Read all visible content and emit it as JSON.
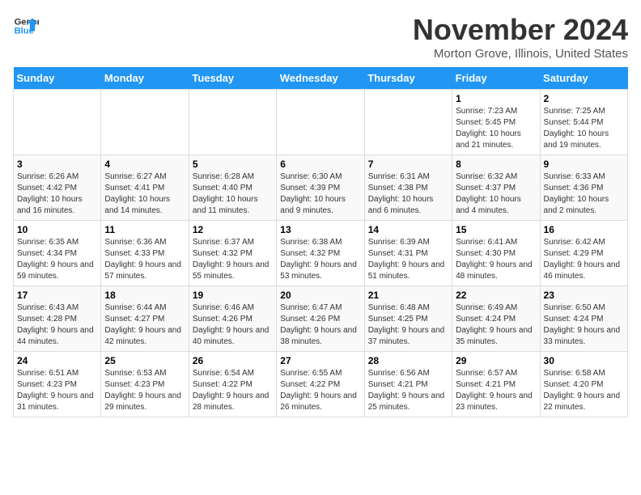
{
  "header": {
    "logo_line1": "General",
    "logo_line2": "Blue",
    "month_title": "November 2024",
    "location": "Morton Grove, Illinois, United States"
  },
  "weekdays": [
    "Sunday",
    "Monday",
    "Tuesday",
    "Wednesday",
    "Thursday",
    "Friday",
    "Saturday"
  ],
  "weeks": [
    [
      {
        "day": "",
        "info": ""
      },
      {
        "day": "",
        "info": ""
      },
      {
        "day": "",
        "info": ""
      },
      {
        "day": "",
        "info": ""
      },
      {
        "day": "",
        "info": ""
      },
      {
        "day": "1",
        "info": "Sunrise: 7:23 AM\nSunset: 5:45 PM\nDaylight: 10 hours and 21 minutes."
      },
      {
        "day": "2",
        "info": "Sunrise: 7:25 AM\nSunset: 5:44 PM\nDaylight: 10 hours and 19 minutes."
      }
    ],
    [
      {
        "day": "3",
        "info": "Sunrise: 6:26 AM\nSunset: 4:42 PM\nDaylight: 10 hours and 16 minutes."
      },
      {
        "day": "4",
        "info": "Sunrise: 6:27 AM\nSunset: 4:41 PM\nDaylight: 10 hours and 14 minutes."
      },
      {
        "day": "5",
        "info": "Sunrise: 6:28 AM\nSunset: 4:40 PM\nDaylight: 10 hours and 11 minutes."
      },
      {
        "day": "6",
        "info": "Sunrise: 6:30 AM\nSunset: 4:39 PM\nDaylight: 10 hours and 9 minutes."
      },
      {
        "day": "7",
        "info": "Sunrise: 6:31 AM\nSunset: 4:38 PM\nDaylight: 10 hours and 6 minutes."
      },
      {
        "day": "8",
        "info": "Sunrise: 6:32 AM\nSunset: 4:37 PM\nDaylight: 10 hours and 4 minutes."
      },
      {
        "day": "9",
        "info": "Sunrise: 6:33 AM\nSunset: 4:36 PM\nDaylight: 10 hours and 2 minutes."
      }
    ],
    [
      {
        "day": "10",
        "info": "Sunrise: 6:35 AM\nSunset: 4:34 PM\nDaylight: 9 hours and 59 minutes."
      },
      {
        "day": "11",
        "info": "Sunrise: 6:36 AM\nSunset: 4:33 PM\nDaylight: 9 hours and 57 minutes."
      },
      {
        "day": "12",
        "info": "Sunrise: 6:37 AM\nSunset: 4:32 PM\nDaylight: 9 hours and 55 minutes."
      },
      {
        "day": "13",
        "info": "Sunrise: 6:38 AM\nSunset: 4:32 PM\nDaylight: 9 hours and 53 minutes."
      },
      {
        "day": "14",
        "info": "Sunrise: 6:39 AM\nSunset: 4:31 PM\nDaylight: 9 hours and 51 minutes."
      },
      {
        "day": "15",
        "info": "Sunrise: 6:41 AM\nSunset: 4:30 PM\nDaylight: 9 hours and 48 minutes."
      },
      {
        "day": "16",
        "info": "Sunrise: 6:42 AM\nSunset: 4:29 PM\nDaylight: 9 hours and 46 minutes."
      }
    ],
    [
      {
        "day": "17",
        "info": "Sunrise: 6:43 AM\nSunset: 4:28 PM\nDaylight: 9 hours and 44 minutes."
      },
      {
        "day": "18",
        "info": "Sunrise: 6:44 AM\nSunset: 4:27 PM\nDaylight: 9 hours and 42 minutes."
      },
      {
        "day": "19",
        "info": "Sunrise: 6:46 AM\nSunset: 4:26 PM\nDaylight: 9 hours and 40 minutes."
      },
      {
        "day": "20",
        "info": "Sunrise: 6:47 AM\nSunset: 4:26 PM\nDaylight: 9 hours and 38 minutes."
      },
      {
        "day": "21",
        "info": "Sunrise: 6:48 AM\nSunset: 4:25 PM\nDaylight: 9 hours and 37 minutes."
      },
      {
        "day": "22",
        "info": "Sunrise: 6:49 AM\nSunset: 4:24 PM\nDaylight: 9 hours and 35 minutes."
      },
      {
        "day": "23",
        "info": "Sunrise: 6:50 AM\nSunset: 4:24 PM\nDaylight: 9 hours and 33 minutes."
      }
    ],
    [
      {
        "day": "24",
        "info": "Sunrise: 6:51 AM\nSunset: 4:23 PM\nDaylight: 9 hours and 31 minutes."
      },
      {
        "day": "25",
        "info": "Sunrise: 6:53 AM\nSunset: 4:23 PM\nDaylight: 9 hours and 29 minutes."
      },
      {
        "day": "26",
        "info": "Sunrise: 6:54 AM\nSunset: 4:22 PM\nDaylight: 9 hours and 28 minutes."
      },
      {
        "day": "27",
        "info": "Sunrise: 6:55 AM\nSunset: 4:22 PM\nDaylight: 9 hours and 26 minutes."
      },
      {
        "day": "28",
        "info": "Sunrise: 6:56 AM\nSunset: 4:21 PM\nDaylight: 9 hours and 25 minutes."
      },
      {
        "day": "29",
        "info": "Sunrise: 6:57 AM\nSunset: 4:21 PM\nDaylight: 9 hours and 23 minutes."
      },
      {
        "day": "30",
        "info": "Sunrise: 6:58 AM\nSunset: 4:20 PM\nDaylight: 9 hours and 22 minutes."
      }
    ]
  ]
}
